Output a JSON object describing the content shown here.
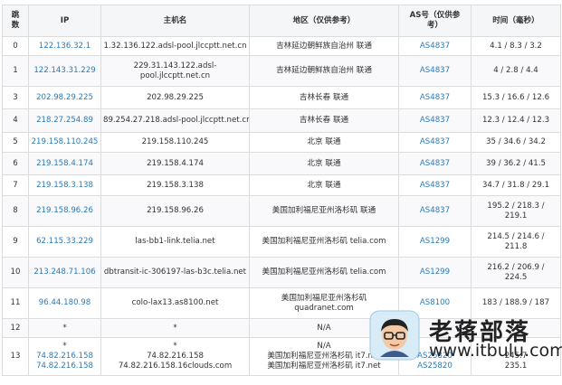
{
  "table": {
    "headers": {
      "hop": "跳数",
      "ip": "IP",
      "host": "主机名",
      "region": "地区（仅供参考）",
      "as": "AS号（仅供参考）",
      "time": "时间（毫秒）"
    },
    "rows": [
      {
        "hop": "0",
        "ip": [
          "122.136.32.1"
        ],
        "host": [
          "1.32.136.122.adsl-pool.jlccptt.net.cn"
        ],
        "region": [
          "吉林延边朝鲜族自治州 联通"
        ],
        "as": [
          "AS4837"
        ],
        "time": [
          "4.1 / 8.3 / 3.2"
        ]
      },
      {
        "hop": "1",
        "ip": [
          "122.143.31.229"
        ],
        "host": [
          "229.31.143.122.adsl-",
          "pool.jlccptt.net.cn"
        ],
        "region": [
          "吉林延边朝鲜族自治州 联通"
        ],
        "as": [
          "AS4837"
        ],
        "time": [
          "4 / 2.8 / 4.4"
        ]
      },
      {
        "hop": "3",
        "ip": [
          "202.98.29.225"
        ],
        "host": [
          "202.98.29.225"
        ],
        "region": [
          "吉林长春 联通"
        ],
        "as": [
          "AS4837"
        ],
        "time": [
          "15.3 / 16.6 / 12.6"
        ]
      },
      {
        "hop": "4",
        "ip": [
          "218.27.254.89"
        ],
        "host": [
          "89.254.27.218.adsl-pool.jlccptt.net.cn"
        ],
        "region": [
          "吉林长春 联通"
        ],
        "as": [
          "AS4837"
        ],
        "time": [
          "12.3 / 12.4 / 12.3"
        ]
      },
      {
        "hop": "5",
        "ip": [
          "219.158.110.245"
        ],
        "host": [
          "219.158.110.245"
        ],
        "region": [
          "北京 联通"
        ],
        "as": [
          "AS4837"
        ],
        "time": [
          "35 / 34.6 / 34.2"
        ]
      },
      {
        "hop": "6",
        "ip": [
          "219.158.4.174"
        ],
        "host": [
          "219.158.4.174"
        ],
        "region": [
          "北京 联通"
        ],
        "as": [
          "AS4837"
        ],
        "time": [
          "39 / 36.2 / 41.5"
        ]
      },
      {
        "hop": "7",
        "ip": [
          "219.158.3.138"
        ],
        "host": [
          "219.158.3.138"
        ],
        "region": [
          "北京 联通"
        ],
        "as": [
          "AS4837"
        ],
        "time": [
          "34.7 / 31.8 / 29.1"
        ]
      },
      {
        "hop": "8",
        "ip": [
          "219.158.96.26"
        ],
        "host": [
          "219.158.96.26"
        ],
        "region": [
          "美国加利福尼亚州洛杉矶 联通"
        ],
        "as": [
          "AS4837"
        ],
        "time": [
          "195.2 / 218.3 /",
          "219.1"
        ]
      },
      {
        "hop": "9",
        "ip": [
          "62.115.33.229"
        ],
        "host": [
          "las-bb1-link.telia.net"
        ],
        "region": [
          "美国加利福尼亚州洛杉矶 telia.com"
        ],
        "as": [
          "AS1299"
        ],
        "time": [
          "214.5 / 214.6 /",
          "211.8"
        ]
      },
      {
        "hop": "10",
        "ip": [
          "213.248.71.106"
        ],
        "host": [
          "dbtransit-ic-306197-las-b3c.telia.net"
        ],
        "region": [
          "美国加利福尼亚州洛杉矶 telia.com"
        ],
        "as": [
          "AS1299"
        ],
        "time": [
          "216.2 / 206.9 /",
          "224.5"
        ]
      },
      {
        "hop": "11",
        "ip": [
          "96.44.180.98"
        ],
        "host": [
          "colo-lax13.as8100.net"
        ],
        "region": [
          "美国加利福尼亚州洛杉矶",
          "quadranet.com"
        ],
        "as": [
          "AS8100"
        ],
        "time": [
          "183 / 188.9 / 187"
        ]
      },
      {
        "hop": "12",
        "ip": [
          "*"
        ],
        "host": [
          "*"
        ],
        "region": [
          "N/A"
        ],
        "as": [
          ""
        ],
        "time": [
          ""
        ]
      },
      {
        "hop": "13",
        "ip": [
          "*",
          "74.82.216.158",
          "74.82.216.158"
        ],
        "host": [
          "*",
          "74.82.216.158",
          "74.82.216.158.16clouds.com"
        ],
        "region": [
          "N/A",
          "美国加利福尼亚州洛杉矶 it7.net",
          "美国加利福尼亚州洛杉矶 it7.net"
        ],
        "as": [
          "",
          "AS25820",
          "AS25820"
        ],
        "time": [
          "",
          "245.7",
          "235.1"
        ]
      }
    ]
  },
  "watermark": {
    "title": "老蒋部落",
    "url": "www.itbulu.com",
    "avatar_icon": "cartoon-glasses-avatar-icon"
  }
}
